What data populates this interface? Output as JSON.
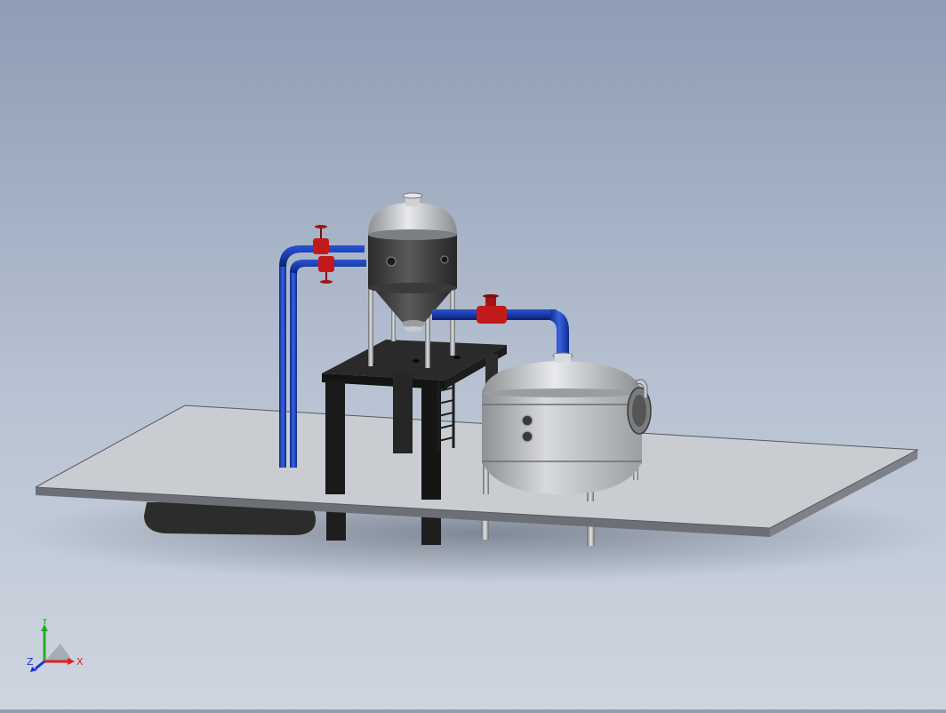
{
  "triad": {
    "x_label": "X",
    "y_label": "Y",
    "z_label": "Z",
    "x_color": "#e02020",
    "y_color": "#20b020",
    "z_color": "#2030d0"
  },
  "colors": {
    "background_top": "#8e9db5",
    "background_bottom": "#ced5df",
    "platform": "#c8cccf",
    "tank_body": "#3a3a3a",
    "tank_shell": "#bfc2c5",
    "pipe": "#1a3aa8",
    "valve": "#c21a1a",
    "frame": "#222222"
  }
}
